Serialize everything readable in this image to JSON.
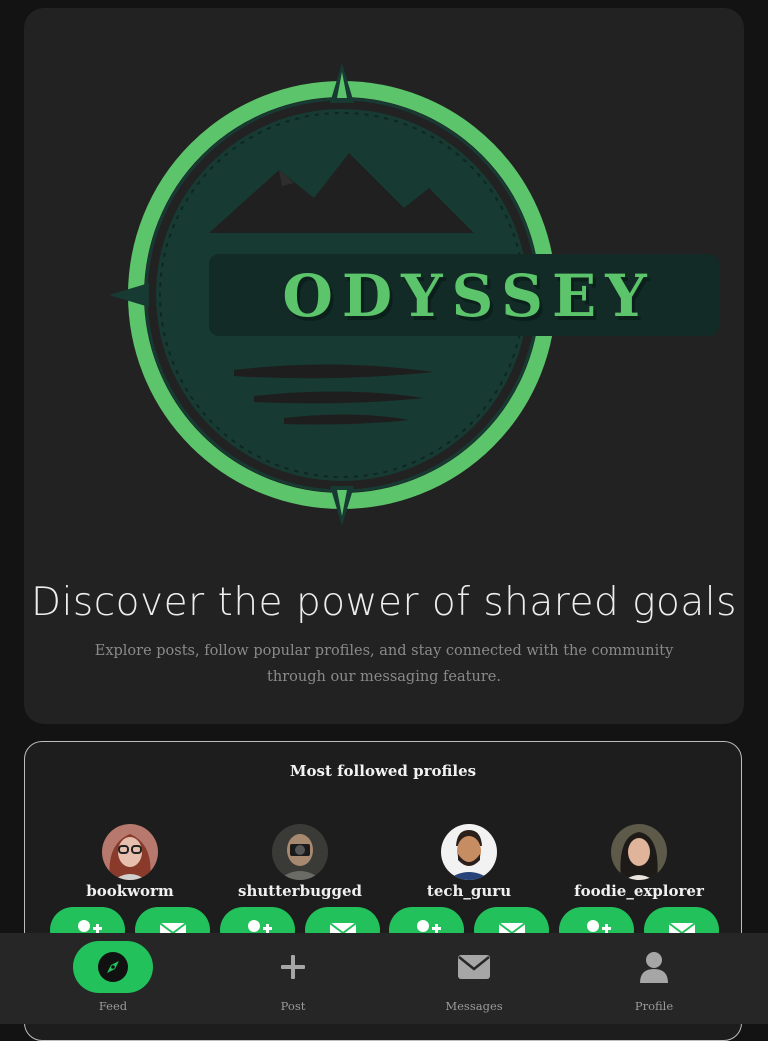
{
  "hero": {
    "logo_text": "ODYSSEY",
    "title": "Discover the power of shared goals",
    "subtitle": "Explore posts, follow popular profiles, and stay connected with the community through our messaging feature."
  },
  "profiles_section": {
    "title": "Most followed profiles",
    "profiles": [
      {
        "username": "bookworm",
        "avatar": "avatar-woman-glasses"
      },
      {
        "username": "shutterbugged",
        "avatar": "avatar-photographer"
      },
      {
        "username": "tech_guru",
        "avatar": "avatar-man-beard"
      },
      {
        "username": "foodie_explorer",
        "avatar": "avatar-woman-dark-hair"
      }
    ],
    "follow_icon": "user-plus-icon",
    "message_icon": "envelope-icon"
  },
  "nav": {
    "items": [
      {
        "label": "Feed",
        "icon": "compass-icon",
        "active": true
      },
      {
        "label": "Post",
        "icon": "plus-icon",
        "active": false
      },
      {
        "label": "Messages",
        "icon": "envelope-icon",
        "active": false
      },
      {
        "label": "Profile",
        "icon": "user-icon",
        "active": false
      }
    ]
  },
  "colors": {
    "accent": "#22c15c",
    "background": "#131313",
    "card": "#222222",
    "logo_dark": "#173a33"
  }
}
